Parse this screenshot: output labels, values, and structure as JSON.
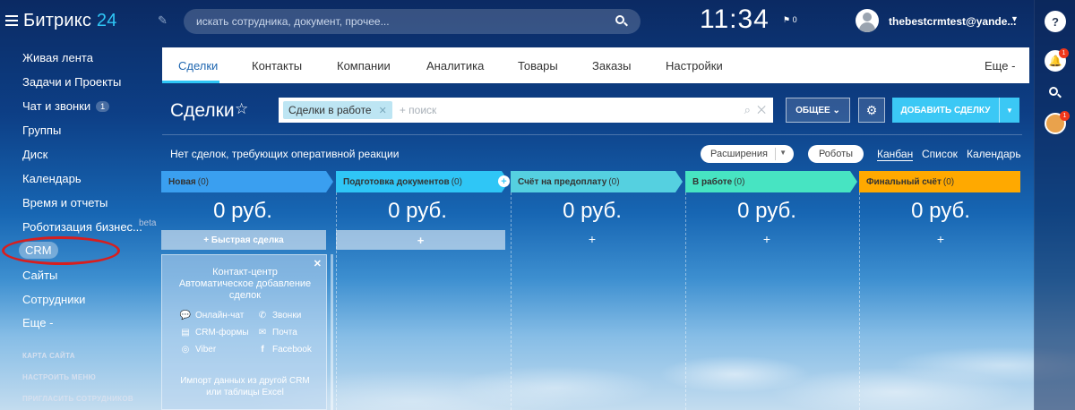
{
  "app": {
    "logo_text": "Битрикс",
    "logo_num": "24",
    "search_placeholder": "искать сотрудника, документ, прочее...",
    "clock": "11:34",
    "flag_count": "0",
    "username": "thebestcrmtest@yande...",
    "notification_badge": "1",
    "avatar_badge": "1"
  },
  "sidebar": {
    "items": [
      {
        "label": "Живая лента"
      },
      {
        "label": "Задачи и Проекты"
      },
      {
        "label": "Чат и звонки",
        "badge": "1"
      },
      {
        "label": "Группы"
      },
      {
        "label": "Диск"
      },
      {
        "label": "Календарь"
      },
      {
        "label": "Время и отчеты"
      },
      {
        "label": "Роботизация бизнес..."
      },
      {
        "label": "CRM"
      },
      {
        "label": "Сайты"
      },
      {
        "label": "Сотрудники"
      },
      {
        "label": "Еще -"
      }
    ],
    "beta": "beta",
    "footer": [
      "КАРТА САЙТА",
      "НАСТРОИТЬ МЕНЮ",
      "ПРИГЛАСИТЬ СОТРУДНИКОВ"
    ]
  },
  "tabs": [
    {
      "label": "Сделки",
      "active": true
    },
    {
      "label": "Контакты"
    },
    {
      "label": "Компании"
    },
    {
      "label": "Аналитика"
    },
    {
      "label": "Товары"
    },
    {
      "label": "Заказы"
    },
    {
      "label": "Настройки"
    },
    {
      "label": "Еще -"
    }
  ],
  "page": {
    "title": "Сделки",
    "filter_chip": "Сделки в работе",
    "filter_placeholder": "+ поиск",
    "general_button": "ОБЩЕЕ",
    "add_button": "ДОБАВИТЬ СДЕЛКУ",
    "no_deals_text": "Нет сделок, требующих оперативной реакции",
    "extensions_button": "Расширения",
    "robots_button": "Роботы",
    "views": [
      "Канбан",
      "Список",
      "Календарь"
    ]
  },
  "columns": [
    {
      "name": "Новая",
      "count": "(0)",
      "sum": "0 руб.",
      "color": "#3a9ff0",
      "quick_label": "Быстрая сделка"
    },
    {
      "name": "Подготовка документов",
      "count": "(0)",
      "sum": "0 руб.",
      "color": "#2fc6f6"
    },
    {
      "name": "Счёт на предоплату",
      "count": "(0)",
      "sum": "0 руб.",
      "color": "#55d0e0"
    },
    {
      "name": "В работе",
      "count": "(0)",
      "sum": "0 руб.",
      "color": "#47e4c2"
    },
    {
      "name": "Финальный счёт",
      "count": "(0)",
      "sum": "0 руб.",
      "color": "#ffa900"
    }
  ],
  "contact_center": {
    "title": "Контакт-центр",
    "subtitle_line1": "Автоматическое добавление",
    "subtitle_line2": "сделок",
    "options": [
      "Онлайн-чат",
      "Звонки",
      "CRM-формы",
      "Почта",
      "Viber",
      "Facebook"
    ],
    "import_line1": "Импорт данных из другой CRM",
    "import_line2": "или таблицы Excel"
  }
}
